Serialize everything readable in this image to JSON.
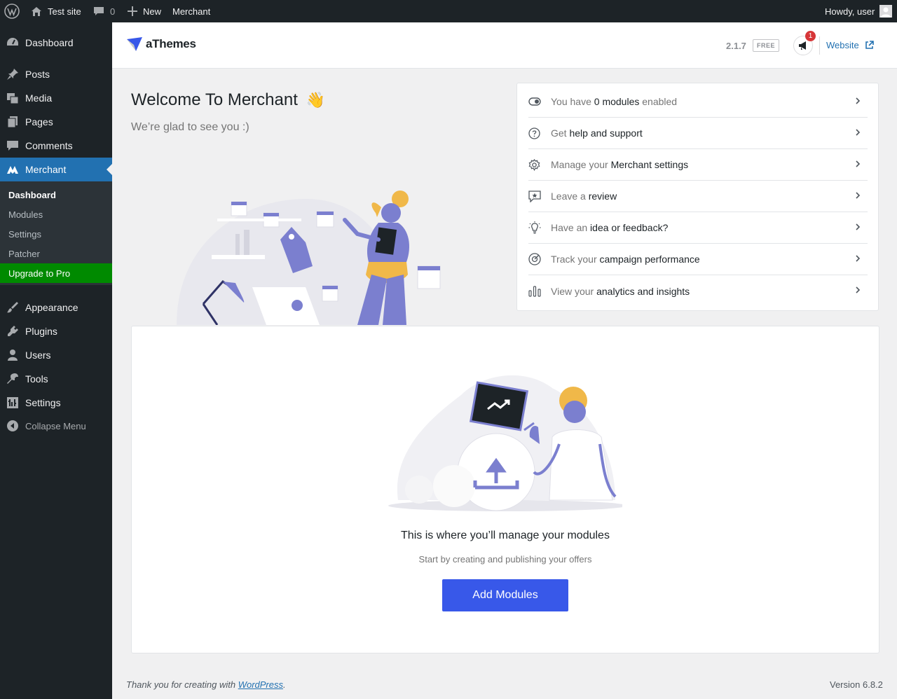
{
  "adminbar": {
    "site_name": "Test site",
    "comments_count": "0",
    "new_label": "New",
    "plugin_link": "Merchant",
    "howdy": "Howdy, user"
  },
  "sidebar": {
    "items": [
      {
        "label": "Dashboard",
        "icon": "dashboard-icon"
      },
      {
        "label": "Posts",
        "icon": "pin-icon"
      },
      {
        "label": "Media",
        "icon": "media-icon"
      },
      {
        "label": "Pages",
        "icon": "pages-icon"
      },
      {
        "label": "Comments",
        "icon": "comment-icon"
      },
      {
        "label": "Merchant",
        "icon": "merchant-icon"
      },
      {
        "label": "Appearance",
        "icon": "brush-icon"
      },
      {
        "label": "Plugins",
        "icon": "plug-icon"
      },
      {
        "label": "Users",
        "icon": "user-icon"
      },
      {
        "label": "Tools",
        "icon": "wrench-icon"
      },
      {
        "label": "Settings",
        "icon": "settings-icon"
      },
      {
        "label": "Collapse Menu",
        "icon": "collapse-icon"
      }
    ],
    "submenu": [
      "Dashboard",
      "Modules",
      "Settings",
      "Patcher",
      "Upgrade to Pro"
    ]
  },
  "header": {
    "logo_text": "aThemes",
    "version": "2.1.7",
    "badge": "FREE",
    "notification_count": "1",
    "website_label": "Website"
  },
  "welcome": {
    "title": "Welcome To Merchant",
    "emoji": "👋",
    "subtitle": "We’re glad to see you :)"
  },
  "quick_links": [
    {
      "muted": "You have ",
      "strong": "0 modules",
      "muted2": " enabled",
      "icon": "toggle-icon"
    },
    {
      "muted": "Get ",
      "strong": "help and support",
      "muted2": "",
      "icon": "help-icon"
    },
    {
      "muted": "Manage your ",
      "strong": "Merchant settings",
      "muted2": "",
      "icon": "gear-icon"
    },
    {
      "muted": "Leave a ",
      "strong": "review",
      "muted2": "",
      "icon": "review-icon"
    },
    {
      "muted": "Have an ",
      "strong": "idea or feedback?",
      "muted2": "",
      "icon": "lightbulb-icon"
    },
    {
      "muted": "Track your ",
      "strong": "campaign performance",
      "muted2": "",
      "icon": "target-icon"
    },
    {
      "muted": "View your ",
      "strong": "analytics and insights",
      "muted2": "",
      "icon": "bar-chart-icon"
    }
  ],
  "modules": {
    "title": "This is where you’ll manage your modules",
    "subtitle": "Start by creating and publishing your offers",
    "button": "Add Modules"
  },
  "footer": {
    "thanks_prefix": "Thank you for creating with ",
    "thanks_link": "WordPress",
    "thanks_suffix": ".",
    "version": "Version 6.8.2"
  },
  "colors": {
    "accent": "#3858e9",
    "wp_blue": "#2271b1",
    "upgrade_green": "#008a00",
    "illustration_purple": "#7b7fcf",
    "illustration_yellow": "#f0b849"
  }
}
